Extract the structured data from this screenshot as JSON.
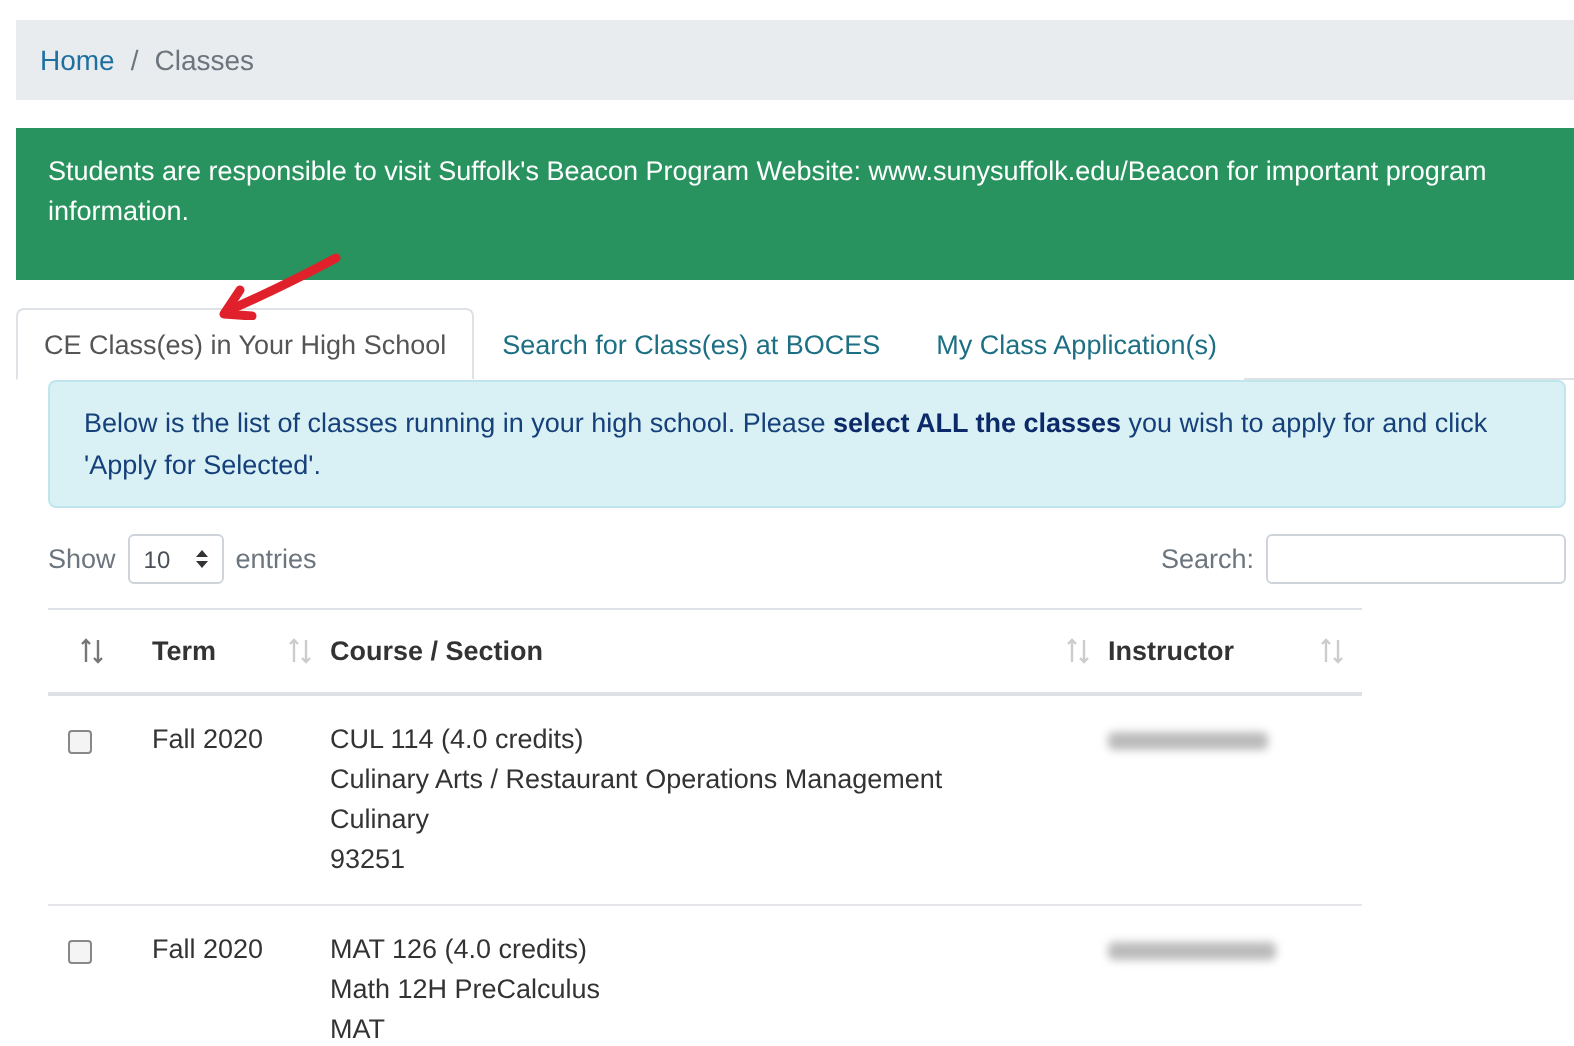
{
  "breadcrumb": {
    "items": [
      "Home",
      "Classes"
    ],
    "separator": "/"
  },
  "notice": "Students are responsible to visit Suffolk's Beacon Program Website: www.sunysuffolk.edu/Beacon for important program information.",
  "tabs": [
    {
      "label": "CE Class(es) in Your High School",
      "selected": true
    },
    {
      "label": "Search for Class(es) at BOCES",
      "selected": false
    },
    {
      "label": "My Class Application(s)",
      "selected": false
    }
  ],
  "info": "Below is the list of classes running in your high school. Please **select ALL the classes** you wish to apply for and click 'Apply for Selected'.",
  "length": {
    "before": "Show",
    "value": "10",
    "after": "entries"
  },
  "search": {
    "label": "Search:"
  },
  "table": {
    "columns": [
      "Term",
      "Course / Section",
      "Instructor"
    ],
    "rows": [
      {
        "checked": false,
        "term": "Fall 2020",
        "course": [
          "CUL 114 (4.0 credits)",
          "Culinary Arts / Restaurant Operations Management",
          "Culinary",
          "93251"
        ]
      },
      {
        "checked": false,
        "term": "Fall 2020",
        "course": [
          "MAT 126 (4.0 credits)",
          "Math 12H PreCalculus",
          "MAT"
        ]
      }
    ]
  }
}
